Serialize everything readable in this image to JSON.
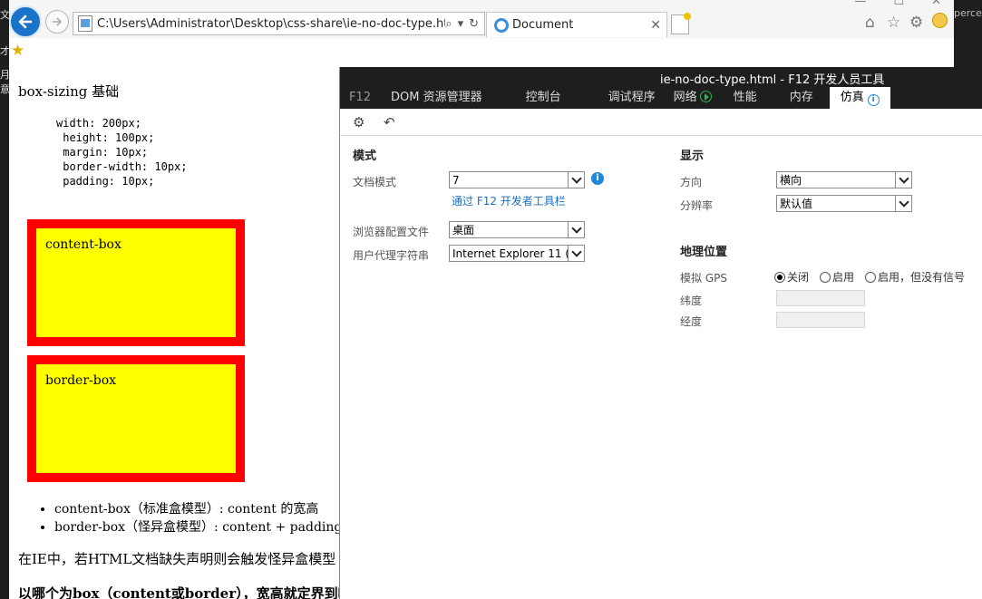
{
  "background": {
    "left_glyphs": [
      "文",
      "才",
      "月",
      "意"
    ],
    "right_text": "percen"
  },
  "browser": {
    "url": "C:\\Users\\Administrator\\Desktop\\css-share\\ie-no-doc-type.htm",
    "tab_title": "Document",
    "window_controls": [
      "—",
      "☐",
      "✕"
    ]
  },
  "page": {
    "heading": "box-sizing 基础",
    "code": "width: 200px;\n height: 100px;\n margin: 10px;\n border-width: 10px;\n padding: 10px;",
    "box1_label": "content-box",
    "box2_label": "border-box",
    "list": [
      "content-box（标准盒模型）: content 的宽高",
      "border-box（怪异盒模型）: content + padding +"
    ],
    "ie_note": "在IE中，若HTML文档缺失声明则会触发怪异盒模型",
    "question": "以哪个为box（content或border），宽高就定界到哪"
  },
  "devtools": {
    "window_title": "ie-no-doc-type.html - F12 开发人员工具",
    "tabs": [
      "F12",
      "DOM 资源管理器",
      "控制台",
      "调试程序",
      "网络",
      "性能",
      "内存",
      "仿真"
    ],
    "active_tab": "仿真",
    "mode_section": {
      "title": "模式",
      "doc_mode_label": "文档模式",
      "doc_mode_value": "7",
      "doc_mode_link": "通过 F12 开发者工具栏",
      "browser_profile_label": "浏览器配置文件",
      "browser_profile_value": "桌面",
      "user_agent_label": "用户代理字符串",
      "user_agent_value": "Internet Explorer 11 (默认)"
    },
    "display_section": {
      "title": "显示",
      "orientation_label": "方向",
      "orientation_value": "横向",
      "resolution_label": "分辨率",
      "resolution_value": "默认值"
    },
    "geo_section": {
      "title": "地理位置",
      "gps_label": "模拟 GPS",
      "gps_options": [
        "关闭",
        "启用",
        "启用，但没有信号"
      ],
      "gps_selected": "关闭",
      "latitude_label": "纬度",
      "longitude_label": "经度",
      "latitude_value": "",
      "longitude_value": ""
    }
  }
}
